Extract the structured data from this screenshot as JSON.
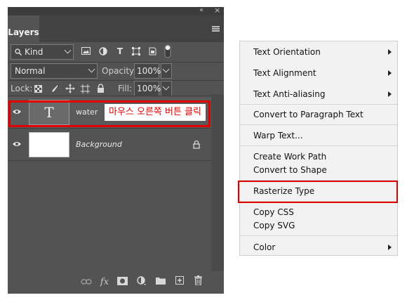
{
  "panel": {
    "tab_label": "Layers",
    "collapse_glyph": "«",
    "close_glyph": "×",
    "menu_icon": "hamburger-icon",
    "filter": {
      "label": "Kind",
      "icons": [
        "image-filter-icon",
        "adjustment-filter-icon",
        "type-filter-icon",
        "shape-filter-icon",
        "smart-object-filter-icon",
        "filter-toggle-icon"
      ]
    },
    "blend_mode": "Normal",
    "opacity_label": "Opacity:",
    "opacity_value": "100%",
    "lock_label": "Lock:",
    "fill_label": "Fill:",
    "fill_value": "100%",
    "layers": [
      {
        "name": "water",
        "type_glyph": "T",
        "callout": "마우스 오른쪽 버튼 클릭"
      },
      {
        "name": "Background"
      }
    ],
    "footer_icons": [
      "link-layers-icon",
      "fx-icon",
      "layer-mask-icon",
      "adjustment-layer-icon",
      "group-folder-icon",
      "new-layer-icon",
      "trash-icon"
    ],
    "fx_label": "fx"
  },
  "context_menu": {
    "items": [
      {
        "label": "Text Orientation",
        "submenu": true
      },
      {
        "label": "Text Alignment",
        "submenu": true
      },
      {
        "label": "Text Anti-aliasing",
        "submenu": true
      },
      {
        "label": "Convert to Paragraph Text"
      },
      {
        "label": "Warp Text..."
      },
      {
        "label": "Create Work Path"
      },
      {
        "label": "Convert to Shape"
      },
      {
        "label": "Rasterize Type",
        "highlighted": true
      },
      {
        "label": "Copy CSS"
      },
      {
        "label": "Copy SVG"
      },
      {
        "label": "Color",
        "submenu": true
      }
    ]
  },
  "colors": {
    "highlight": "#e00000",
    "panel_bg": "#535353",
    "menu_bg": "#f2f2f2"
  }
}
